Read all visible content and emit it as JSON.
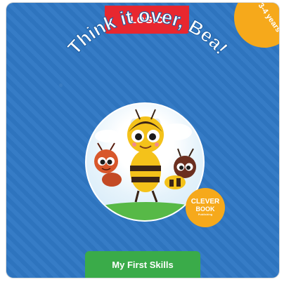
{
  "top_badge": {
    "label": "LOGIC"
  },
  "age_badge": {
    "label": "3-4 years"
  },
  "title": {
    "text": "Think it over, Bea!"
  },
  "brand_logo": {
    "line1": "CLEVER",
    "line2": "BOOK",
    "line3": "Publishing"
  },
  "bottom_badge": {
    "label": "My First Skills"
  },
  "colors": {
    "background": "#2f78c4",
    "top_badge": "#e8272f",
    "age_badge": "#f6a91b",
    "bottom_badge": "#3aab49",
    "title_text": "#ffffff"
  },
  "icons": [
    "bee-character",
    "red-ant-character",
    "brown-ant-character",
    "cloud-icon"
  ]
}
